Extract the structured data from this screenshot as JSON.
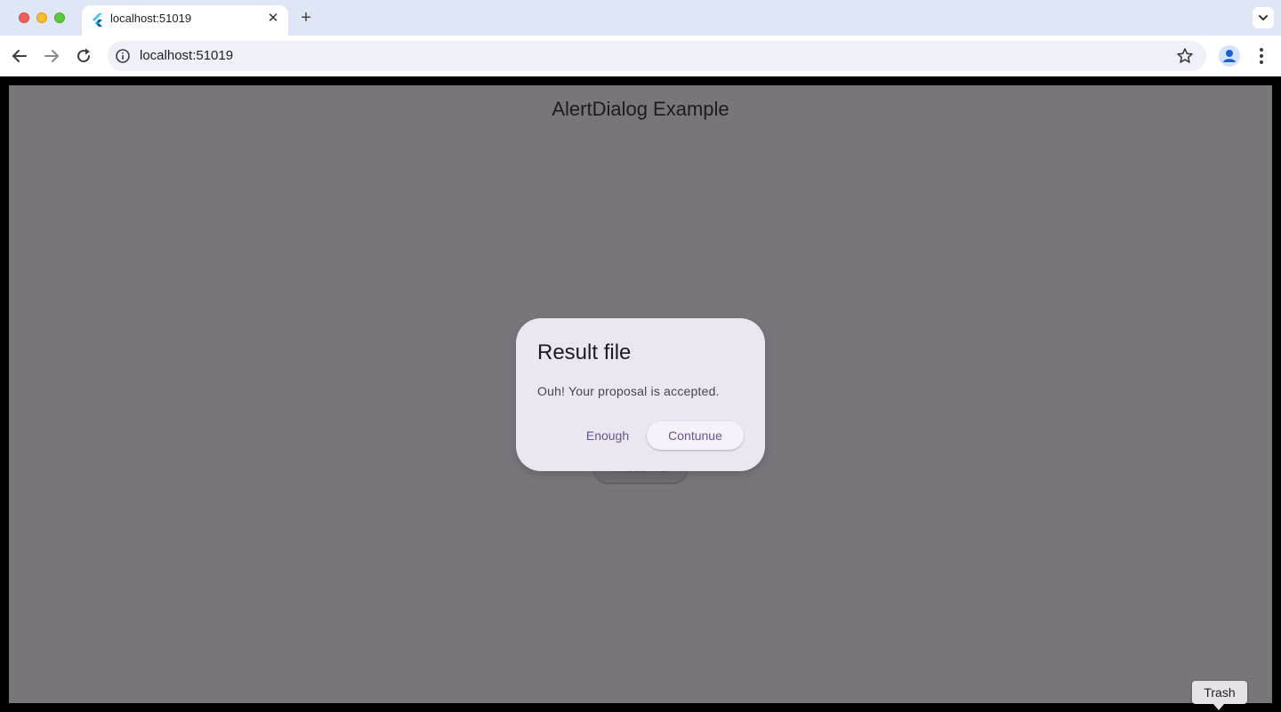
{
  "browser": {
    "tab": {
      "title": "localhost:51019",
      "close_glyph": "✕",
      "favicon": "flutter-icon"
    },
    "new_tab_glyph": "+",
    "address_bar": {
      "url": "localhost:51019"
    },
    "icons": [
      "back-arrow-icon",
      "forward-arrow-icon",
      "reload-icon",
      "site-info-icon",
      "bookmark-star-icon",
      "profile-icon",
      "more-menu-icon",
      "tab-search-chevron-icon"
    ]
  },
  "app": {
    "title": "AlertDialog Example",
    "background_button_label": "Press Me"
  },
  "dialog": {
    "title": "Result file",
    "content": "Ouh! Your proposal is accepted.",
    "actions": {
      "enough": "Enough",
      "continue": "Contunue"
    }
  },
  "tooltip": {
    "text": "Trash"
  },
  "colors": {
    "scrim_background": "#79767b",
    "dialog_surface": "#ece6f0",
    "action_text": "#65558f",
    "tab_strip": "#dfe6f6"
  }
}
